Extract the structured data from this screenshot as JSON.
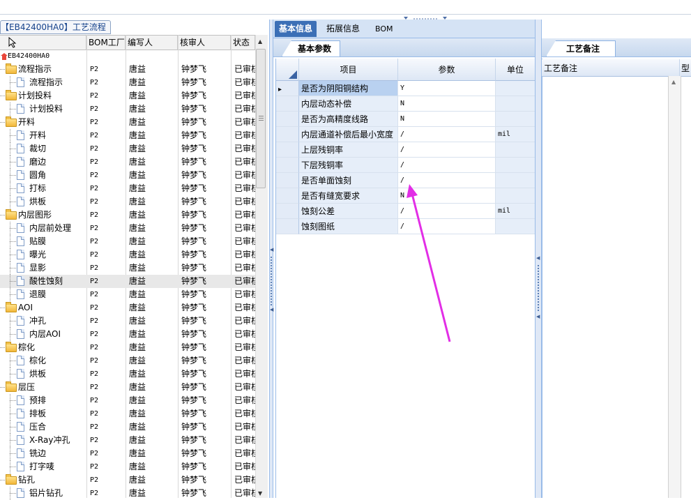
{
  "left_panel": {
    "caption": "【EB42400HA0】工艺流程",
    "columns": {
      "bom": "BOM工厂",
      "writer": "编写人",
      "reviewer": "核审人",
      "status": "状态"
    },
    "root_label": "EB42400HA0",
    "rows": [
      {
        "label": "流程指示",
        "type": "folder",
        "bom": "P2",
        "writer": "唐益",
        "reviewer": "钟梦飞",
        "status": "已审核"
      },
      {
        "label": "流程指示",
        "type": "item",
        "bom": "P2",
        "writer": "唐益",
        "reviewer": "钟梦飞",
        "status": "已审核"
      },
      {
        "label": "计划投料",
        "type": "folder",
        "bom": "P2",
        "writer": "唐益",
        "reviewer": "钟梦飞",
        "status": "已审核"
      },
      {
        "label": "计划投料",
        "type": "item",
        "bom": "P2",
        "writer": "唐益",
        "reviewer": "钟梦飞",
        "status": "已审核"
      },
      {
        "label": "开料",
        "type": "folder",
        "bom": "P2",
        "writer": "唐益",
        "reviewer": "钟梦飞",
        "status": "已审核"
      },
      {
        "label": "开料",
        "type": "item",
        "bom": "P2",
        "writer": "唐益",
        "reviewer": "钟梦飞",
        "status": "已审核"
      },
      {
        "label": "裁切",
        "type": "item",
        "bom": "P2",
        "writer": "唐益",
        "reviewer": "钟梦飞",
        "status": "已审核"
      },
      {
        "label": "磨边",
        "type": "item",
        "bom": "P2",
        "writer": "唐益",
        "reviewer": "钟梦飞",
        "status": "已审核"
      },
      {
        "label": "圆角",
        "type": "item",
        "bom": "P2",
        "writer": "唐益",
        "reviewer": "钟梦飞",
        "status": "已审核"
      },
      {
        "label": "打标",
        "type": "item",
        "bom": "P2",
        "writer": "唐益",
        "reviewer": "钟梦飞",
        "status": "已审核"
      },
      {
        "label": "烘板",
        "type": "item",
        "bom": "P2",
        "writer": "唐益",
        "reviewer": "钟梦飞",
        "status": "已审核"
      },
      {
        "label": "内层图形",
        "type": "folder",
        "bom": "P2",
        "writer": "唐益",
        "reviewer": "钟梦飞",
        "status": "已审核"
      },
      {
        "label": "内层前处理",
        "type": "item",
        "bom": "P2",
        "writer": "唐益",
        "reviewer": "钟梦飞",
        "status": "已审核"
      },
      {
        "label": "贴膜",
        "type": "item",
        "bom": "P2",
        "writer": "唐益",
        "reviewer": "钟梦飞",
        "status": "已审核"
      },
      {
        "label": "曝光",
        "type": "item",
        "bom": "P2",
        "writer": "唐益",
        "reviewer": "钟梦飞",
        "status": "已审核"
      },
      {
        "label": "显影",
        "type": "item",
        "bom": "P2",
        "writer": "唐益",
        "reviewer": "钟梦飞",
        "status": "已审核"
      },
      {
        "label": "酸性蚀刻",
        "type": "item",
        "bom": "P2",
        "writer": "唐益",
        "reviewer": "钟梦飞",
        "status": "已审核",
        "selected": true
      },
      {
        "label": "退膜",
        "type": "item",
        "bom": "P2",
        "writer": "唐益",
        "reviewer": "钟梦飞",
        "status": "已审核"
      },
      {
        "label": "AOI",
        "type": "folder",
        "bom": "P2",
        "writer": "唐益",
        "reviewer": "钟梦飞",
        "status": "已审核"
      },
      {
        "label": "冲孔",
        "type": "item",
        "bom": "P2",
        "writer": "唐益",
        "reviewer": "钟梦飞",
        "status": "已审核"
      },
      {
        "label": "内层AOI",
        "type": "item",
        "bom": "P2",
        "writer": "唐益",
        "reviewer": "钟梦飞",
        "status": "已审核"
      },
      {
        "label": "棕化",
        "type": "folder",
        "bom": "P2",
        "writer": "唐益",
        "reviewer": "钟梦飞",
        "status": "已审核"
      },
      {
        "label": "棕化",
        "type": "item",
        "bom": "P2",
        "writer": "唐益",
        "reviewer": "钟梦飞",
        "status": "已审核"
      },
      {
        "label": "烘板",
        "type": "item",
        "bom": "P2",
        "writer": "唐益",
        "reviewer": "钟梦飞",
        "status": "已审核"
      },
      {
        "label": "层压",
        "type": "folder",
        "bom": "P2",
        "writer": "唐益",
        "reviewer": "钟梦飞",
        "status": "已审核"
      },
      {
        "label": "预排",
        "type": "item",
        "bom": "P2",
        "writer": "唐益",
        "reviewer": "钟梦飞",
        "status": "已审核"
      },
      {
        "label": "排板",
        "type": "item",
        "bom": "P2",
        "writer": "唐益",
        "reviewer": "钟梦飞",
        "status": "已审核"
      },
      {
        "label": "压合",
        "type": "item",
        "bom": "P2",
        "writer": "唐益",
        "reviewer": "钟梦飞",
        "status": "已审核"
      },
      {
        "label": "X-Ray冲孔",
        "type": "item",
        "bom": "P2",
        "writer": "唐益",
        "reviewer": "钟梦飞",
        "status": "已审核"
      },
      {
        "label": "铣边",
        "type": "item",
        "bom": "P2",
        "writer": "唐益",
        "reviewer": "钟梦飞",
        "status": "已审核"
      },
      {
        "label": "打字唛",
        "type": "item",
        "bom": "P2",
        "writer": "唐益",
        "reviewer": "钟梦飞",
        "status": "已审核"
      },
      {
        "label": "钻孔",
        "type": "folder",
        "bom": "P2",
        "writer": "唐益",
        "reviewer": "钟梦飞",
        "status": "已审核"
      },
      {
        "label": "铝片钻孔",
        "type": "item",
        "bom": "P2",
        "writer": "唐益",
        "reviewer": "钟梦飞",
        "status": "已审核"
      }
    ]
  },
  "middle_panel": {
    "tabs": [
      "基本信息",
      "拓展信息",
      "BOM"
    ],
    "active_tab": "基本信息",
    "subtab": "基本参数",
    "columns": {
      "item": "项目",
      "param": "参数",
      "unit": "单位"
    },
    "rows": [
      {
        "item": "是否为阴阳铜结构",
        "param": "Y",
        "unit": "",
        "current": true
      },
      {
        "item": "内层动态补偿",
        "param": "N",
        "unit": ""
      },
      {
        "item": "是否为高精度线路",
        "param": "N",
        "unit": ""
      },
      {
        "item": "内层通道补偿后最小宽度",
        "param": "/",
        "unit": "mil"
      },
      {
        "item": "上层残铜率",
        "param": "/",
        "unit": ""
      },
      {
        "item": "下层残铜率",
        "param": "/",
        "unit": ""
      },
      {
        "item": "是否单面蚀刻",
        "param": "/",
        "unit": ""
      },
      {
        "item": "是否有缝宽要求",
        "param": "N",
        "unit": ""
      },
      {
        "item": "蚀刻公差",
        "param": "/",
        "unit": "mil"
      },
      {
        "item": "蚀刻图纸",
        "param": "/",
        "unit": ""
      }
    ]
  },
  "right_panel": {
    "subtab": "工艺备注",
    "column": "工艺备注",
    "column2": "型"
  },
  "icons": {
    "row_pointer": "row-pointer-icon",
    "corner": "grid-corner-icon",
    "arrow_annotation": "arrow-annotation-icon"
  },
  "colors": {
    "active_tab": "#3b6fb6",
    "annotation_arrow": "#e22ee6",
    "grid_item_bg": "#e6eef9"
  }
}
